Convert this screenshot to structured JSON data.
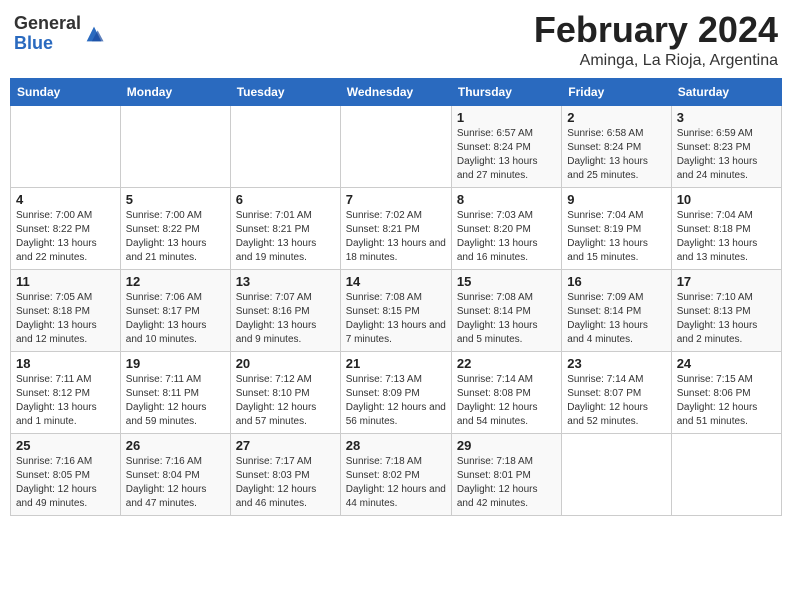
{
  "header": {
    "logo_general": "General",
    "logo_blue": "Blue",
    "month_year": "February 2024",
    "location": "Aminga, La Rioja, Argentina"
  },
  "days_header": [
    "Sunday",
    "Monday",
    "Tuesday",
    "Wednesday",
    "Thursday",
    "Friday",
    "Saturday"
  ],
  "weeks": [
    [
      {
        "day": "",
        "info": ""
      },
      {
        "day": "",
        "info": ""
      },
      {
        "day": "",
        "info": ""
      },
      {
        "day": "",
        "info": ""
      },
      {
        "day": "1",
        "info": "Sunrise: 6:57 AM\nSunset: 8:24 PM\nDaylight: 13 hours and 27 minutes."
      },
      {
        "day": "2",
        "info": "Sunrise: 6:58 AM\nSunset: 8:24 PM\nDaylight: 13 hours and 25 minutes."
      },
      {
        "day": "3",
        "info": "Sunrise: 6:59 AM\nSunset: 8:23 PM\nDaylight: 13 hours and 24 minutes."
      }
    ],
    [
      {
        "day": "4",
        "info": "Sunrise: 7:00 AM\nSunset: 8:22 PM\nDaylight: 13 hours and 22 minutes."
      },
      {
        "day": "5",
        "info": "Sunrise: 7:00 AM\nSunset: 8:22 PM\nDaylight: 13 hours and 21 minutes."
      },
      {
        "day": "6",
        "info": "Sunrise: 7:01 AM\nSunset: 8:21 PM\nDaylight: 13 hours and 19 minutes."
      },
      {
        "day": "7",
        "info": "Sunrise: 7:02 AM\nSunset: 8:21 PM\nDaylight: 13 hours and 18 minutes."
      },
      {
        "day": "8",
        "info": "Sunrise: 7:03 AM\nSunset: 8:20 PM\nDaylight: 13 hours and 16 minutes."
      },
      {
        "day": "9",
        "info": "Sunrise: 7:04 AM\nSunset: 8:19 PM\nDaylight: 13 hours and 15 minutes."
      },
      {
        "day": "10",
        "info": "Sunrise: 7:04 AM\nSunset: 8:18 PM\nDaylight: 13 hours and 13 minutes."
      }
    ],
    [
      {
        "day": "11",
        "info": "Sunrise: 7:05 AM\nSunset: 8:18 PM\nDaylight: 13 hours and 12 minutes."
      },
      {
        "day": "12",
        "info": "Sunrise: 7:06 AM\nSunset: 8:17 PM\nDaylight: 13 hours and 10 minutes."
      },
      {
        "day": "13",
        "info": "Sunrise: 7:07 AM\nSunset: 8:16 PM\nDaylight: 13 hours and 9 minutes."
      },
      {
        "day": "14",
        "info": "Sunrise: 7:08 AM\nSunset: 8:15 PM\nDaylight: 13 hours and 7 minutes."
      },
      {
        "day": "15",
        "info": "Sunrise: 7:08 AM\nSunset: 8:14 PM\nDaylight: 13 hours and 5 minutes."
      },
      {
        "day": "16",
        "info": "Sunrise: 7:09 AM\nSunset: 8:14 PM\nDaylight: 13 hours and 4 minutes."
      },
      {
        "day": "17",
        "info": "Sunrise: 7:10 AM\nSunset: 8:13 PM\nDaylight: 13 hours and 2 minutes."
      }
    ],
    [
      {
        "day": "18",
        "info": "Sunrise: 7:11 AM\nSunset: 8:12 PM\nDaylight: 13 hours and 1 minute."
      },
      {
        "day": "19",
        "info": "Sunrise: 7:11 AM\nSunset: 8:11 PM\nDaylight: 12 hours and 59 minutes."
      },
      {
        "day": "20",
        "info": "Sunrise: 7:12 AM\nSunset: 8:10 PM\nDaylight: 12 hours and 57 minutes."
      },
      {
        "day": "21",
        "info": "Sunrise: 7:13 AM\nSunset: 8:09 PM\nDaylight: 12 hours and 56 minutes."
      },
      {
        "day": "22",
        "info": "Sunrise: 7:14 AM\nSunset: 8:08 PM\nDaylight: 12 hours and 54 minutes."
      },
      {
        "day": "23",
        "info": "Sunrise: 7:14 AM\nSunset: 8:07 PM\nDaylight: 12 hours and 52 minutes."
      },
      {
        "day": "24",
        "info": "Sunrise: 7:15 AM\nSunset: 8:06 PM\nDaylight: 12 hours and 51 minutes."
      }
    ],
    [
      {
        "day": "25",
        "info": "Sunrise: 7:16 AM\nSunset: 8:05 PM\nDaylight: 12 hours and 49 minutes."
      },
      {
        "day": "26",
        "info": "Sunrise: 7:16 AM\nSunset: 8:04 PM\nDaylight: 12 hours and 47 minutes."
      },
      {
        "day": "27",
        "info": "Sunrise: 7:17 AM\nSunset: 8:03 PM\nDaylight: 12 hours and 46 minutes."
      },
      {
        "day": "28",
        "info": "Sunrise: 7:18 AM\nSunset: 8:02 PM\nDaylight: 12 hours and 44 minutes."
      },
      {
        "day": "29",
        "info": "Sunrise: 7:18 AM\nSunset: 8:01 PM\nDaylight: 12 hours and 42 minutes."
      },
      {
        "day": "",
        "info": ""
      },
      {
        "day": "",
        "info": ""
      }
    ]
  ]
}
